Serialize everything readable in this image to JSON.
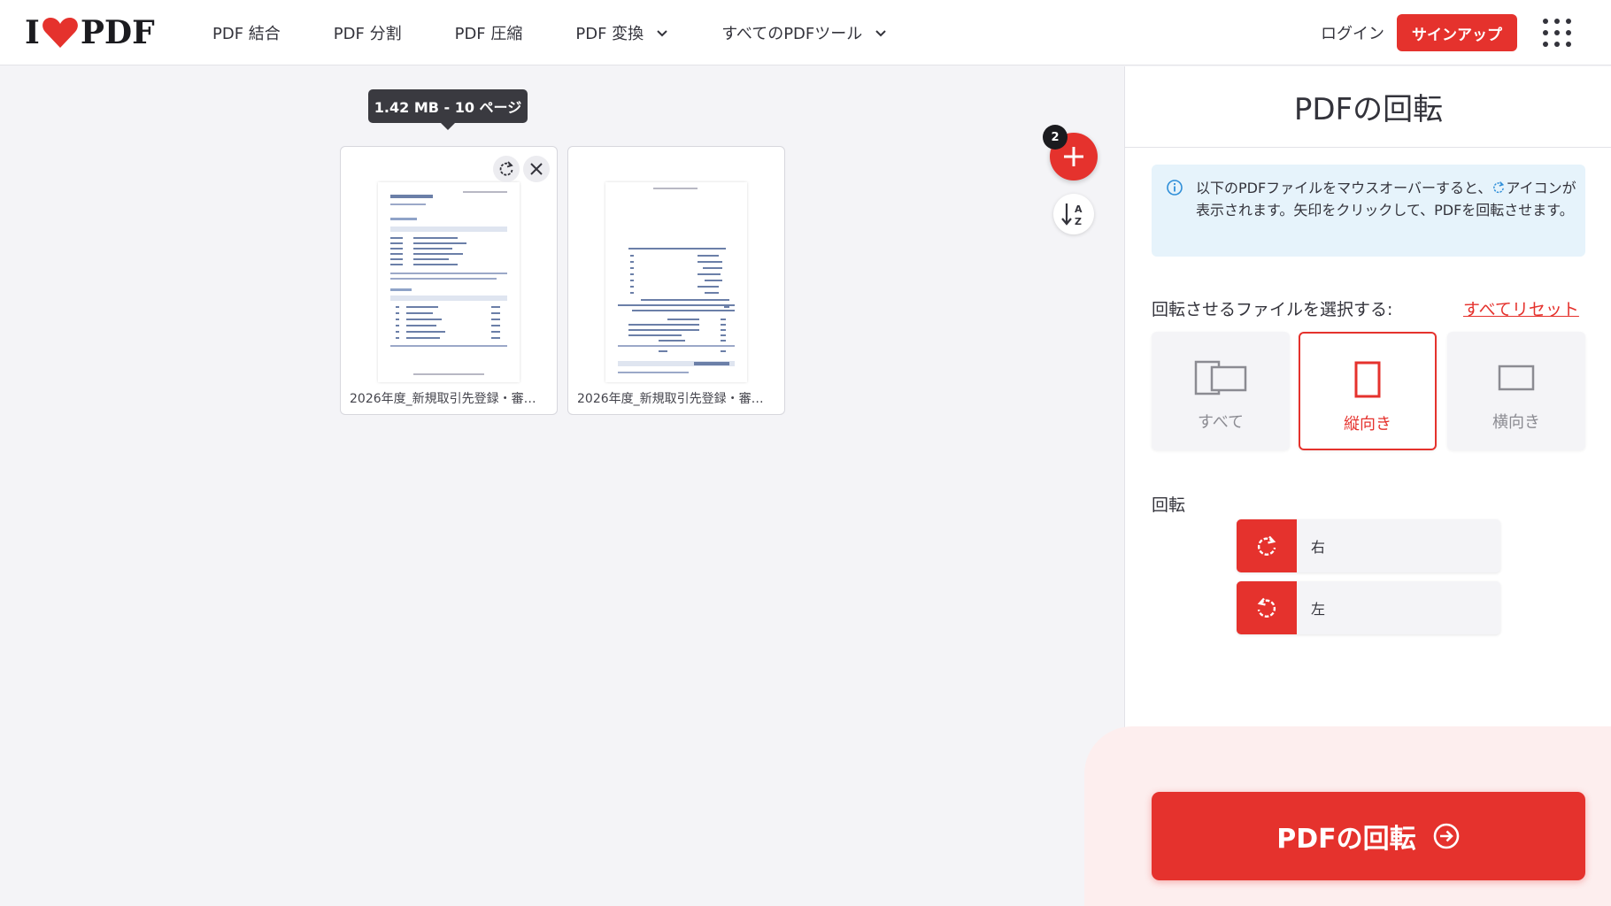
{
  "header": {
    "logo_left": "I",
    "logo_right": "PDF",
    "nav": [
      {
        "label": "PDF 結合"
      },
      {
        "label": "PDF 分割"
      },
      {
        "label": "PDF 圧縮"
      },
      {
        "label": "PDF 変換",
        "dropdown": true
      },
      {
        "label": "すべてのPDFツール",
        "dropdown": true
      }
    ],
    "login": "ログイン",
    "signup": "サインアップ",
    "icons": {
      "logo": "heart-icon",
      "apps": "grid-apps-icon",
      "chevron": "chevron-down-icon"
    }
  },
  "workspace": {
    "tooltip": "1.42 MB - 10 ページ",
    "files": [
      {
        "name": "2026年度_新規取引先登録・審…"
      },
      {
        "name": "2026年度_新規取引先登録・審…"
      }
    ],
    "file_count_badge": "2",
    "icons": {
      "rotate": "rotate-icon",
      "remove": "close-icon",
      "add": "plus-icon",
      "sort": "sort-az-icon"
    }
  },
  "sidebar": {
    "title": "PDFの回転",
    "info_before_icon": "以下のPDFファイルをマウスオーバーすると、",
    "info_after_icon": "アイコンが表示されます。矢印をクリックして、PDFを回転させます。",
    "select_label": "回転させるファイルを選択する:",
    "reset_label": "すべてリセット",
    "options": [
      {
        "label": "すべて",
        "icon": "all-pages-icon",
        "selected": false
      },
      {
        "label": "縦向き",
        "icon": "portrait-icon",
        "selected": true
      },
      {
        "label": "横向き",
        "icon": "landscape-icon",
        "selected": false
      }
    ],
    "rotation_label": "回転",
    "rotate_right": "右",
    "rotate_left": "左",
    "action_button": "PDFの回転",
    "colors": {
      "accent": "#e5322d",
      "info_bg": "#e6f3fb",
      "info_icon": "#2e8ed8"
    }
  }
}
